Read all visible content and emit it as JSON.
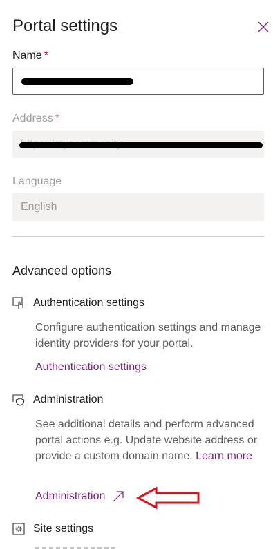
{
  "panel": {
    "title": "Portal settings"
  },
  "name_field": {
    "label": "Name",
    "required_mark": "*"
  },
  "address_field": {
    "label": "Address",
    "required_mark": "*",
    "value_partial": "https://mycommunity"
  },
  "language_field": {
    "label": "Language",
    "value": "English"
  },
  "advanced": {
    "title": "Advanced options",
    "authentication": {
      "heading": "Authentication settings",
      "description": "Configure authentication settings and manage identity providers for your portal.",
      "link": "Authentication settings"
    },
    "administration": {
      "heading": "Administration",
      "description": "See additional details and perform advanced portal actions e.g. Update website address or provide a custom domain name.",
      "learn_more": "Learn more",
      "link": "Administration"
    },
    "site_settings": {
      "heading": "Site settings"
    }
  },
  "colors": {
    "link": "#742774",
    "annotation_arrow": "#e0101a"
  },
  "icons": {
    "close": "close-icon",
    "authentication": "touch-shield-icon",
    "administration": "shield-window-icon",
    "site_settings": "settings-window-icon",
    "external": "external-link-icon"
  }
}
